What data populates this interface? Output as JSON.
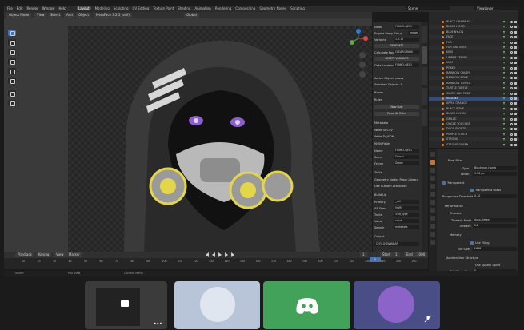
{
  "menu": [
    "File",
    "Edit",
    "Render",
    "Window",
    "Help"
  ],
  "workspaces": [
    "Layout",
    "Modeling",
    "Sculpting",
    "UV Editing",
    "Texture Paint",
    "Shading",
    "Animation",
    "Rendering",
    "Compositing",
    "Geometry Nodes",
    "Scripting"
  ],
  "scene": "Scene",
  "view_layer": "ViewLayer",
  "header": {
    "mode": "Object Mode",
    "view": "View",
    "select": "Select",
    "add": "Add",
    "object": "Object",
    "file_name": "MetaFace 3.2.5 (self)",
    "orientation": "Global"
  },
  "npanel": {
    "items": [
      {
        "label": "Node",
        "value": "FUNKO-QEX1"
      },
      {
        "label": "Engine Proxy Setup",
        "value": "Image"
      },
      {
        "label": "Variants",
        "value": "1.3.15"
      },
      {
        "label": "",
        "value": "GENERATE"
      },
      {
        "label": "Calculate Pass",
        "value": "CLEARGBNOX"
      },
      {
        "label": "",
        "value": "DELETE VARIANTS"
      },
      {
        "label": "Data Location",
        "value": "FUNKO-QEX1"
      }
    ],
    "active_object": "Active Object: proxy",
    "selected_objects": "Selected Objects: 0",
    "sections": [
      "Bones",
      "Rules"
    ],
    "new_rule": "New Rule",
    "reset_rules": "Reset All Rules",
    "metadata": "Metadata",
    "write_csv": "Write To CSV",
    "write_json": "Write To JSON",
    "json_fields": "JSON Fields",
    "fields": [
      {
        "label": "Name",
        "value": "FUNKO-QEX1"
      },
      {
        "label": "Seen",
        "value": "Sensei"
      },
      {
        "label": "Frame",
        "value": "Sneak"
      }
    ],
    "traits": "Traits",
    "geometry_nodes": "Geometry Nodes Proxy Library",
    "custom_attributes": "Use Custom Attributes",
    "build_up": "Build Up",
    "build_fields": [
      {
        "label": "Primary",
        "value": "_cell"
      },
      {
        "label": "AB Files",
        "value": "IVARS"
      },
      {
        "label": "Traits",
        "value": "Trait_type"
      },
      {
        "label": "Value",
        "value": "value"
      },
      {
        "label": "Search",
        "value": "metadata"
      }
    ],
    "output": "Output",
    "output_path": "C:\\FILO\\SWINNAP"
  },
  "outliner": {
    "rows": [
      "BLACK CHAINBAG",
      "BLACK HOOD",
      "BLUE NYLON",
      "FACE",
      "FUR",
      "FUR CAN SHOE",
      "KIDS",
      "LIMBER TENNIS",
      "NUM",
      "POKEY",
      "RAINBOW CANDY",
      "RAINBOW BONE",
      "RAINBOW TOWEL",
      "TURTLE TURTLE",
      "SILVER CAN PASS",
      "VEGGIES",
      "APPLE ORANGE",
      "BLACK BONE",
      "BLACK NYLON",
      "GRILLS",
      "CIRCLE TOUCHES",
      "DOGS SPORTS",
      "PURPLE TOUCH",
      "STRONG",
      "STRONG GREEN"
    ],
    "selected_index": 15
  },
  "properties": {
    "film_filter": "Pixel Filter",
    "type_label": "Type",
    "type_value": "Blackman-Harris",
    "width_label": "Width",
    "width_value": "1.50 px",
    "transparent": "Transparent",
    "transparent_glass": "Transparent Glass",
    "roughness_label": "Roughness Threshold",
    "roughness_value": "0.10",
    "performance": "Performance",
    "threads": "Threads",
    "threads_mode_label": "Threads Mode",
    "threads_mode_value": "Auto-Detect",
    "threads_label": "Threads",
    "threads_value": "24",
    "memory": "Memory",
    "use_tiling": "Use Tiling",
    "tile_size_label": "Tile Size",
    "tile_size_value": "2048",
    "acceleration": "Acceleration Structure",
    "use_spatial": "Use Spatial Splits",
    "bvh_label": "BVH Time Steps",
    "bvh_value": "0"
  },
  "timeline": {
    "playback": "Playback",
    "keying": "Keying",
    "view": "View",
    "marker": "Marker",
    "current_frame": "1",
    "start_label": "Start",
    "start_value": "1",
    "end_label": "End",
    "end_value": "1000",
    "ticks": [
      "10",
      "20",
      "30",
      "40",
      "50",
      "60",
      "70",
      "80",
      "90",
      "100",
      "110",
      "120",
      "130",
      "140",
      "150",
      "160",
      "170",
      "180",
      "190",
      "200",
      "210",
      "220",
      "230",
      "240",
      "250",
      "260"
    ]
  },
  "status": {
    "select": "Select",
    "pan": "Pan View",
    "context": "Context Menu"
  },
  "colors": {
    "accent_blue": "#4772b3",
    "discord_green": "#43a25a",
    "tile4_purple": "#4a4e86"
  }
}
